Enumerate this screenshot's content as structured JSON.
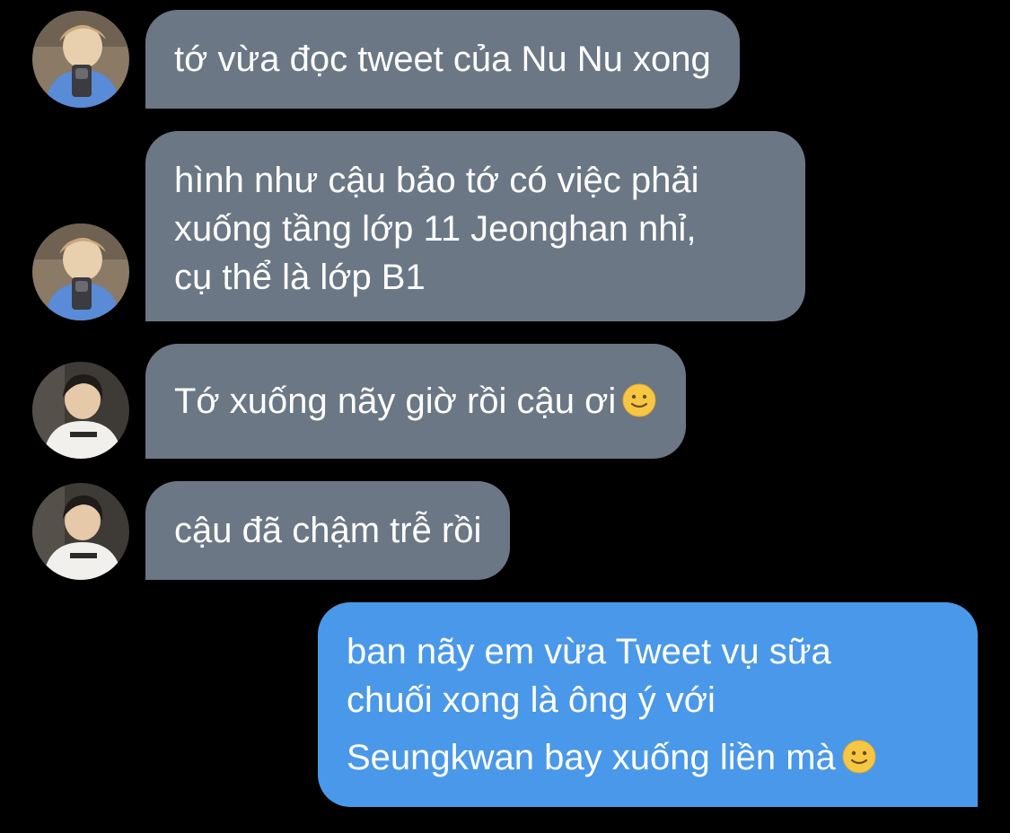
{
  "conversation": {
    "messages": [
      {
        "sender": "incoming",
        "avatar": "blond-boy-mirror-selfie",
        "lines": [
          "tớ vừa đọc tweet của Nu Nu xong"
        ]
      },
      {
        "sender": "incoming",
        "avatar": "blond-boy-mirror-selfie",
        "lines": [
          "hình như cậu bảo tớ có việc phải",
          "xuống tầng lớp 11 Jeonghan nhỉ,",
          "cụ thể là lớp B1"
        ]
      },
      {
        "sender": "incoming",
        "avatar": "dark-hair-white-tee",
        "lines": [
          "Tớ xuống nãy giờ rồi cậu ơi"
        ],
        "trailing_emoji": "slightly-smiling-face-emoji"
      },
      {
        "sender": "incoming",
        "avatar": "dark-hair-white-tee",
        "lines": [
          "cậu đã chậm trễ rồi"
        ]
      },
      {
        "sender": "outgoing",
        "lines": [
          "ban nãy em vừa Tweet vụ sữa",
          "chuối xong là ông ý với",
          "Seungkwan bay xuống liền mà"
        ],
        "trailing_emoji": "slightly-smiling-face-emoji"
      }
    ]
  },
  "colors": {
    "background": "#000000",
    "incoming_bubble": "#6b7785",
    "outgoing_bubble": "#4a98e9",
    "text": "#ffffff"
  }
}
